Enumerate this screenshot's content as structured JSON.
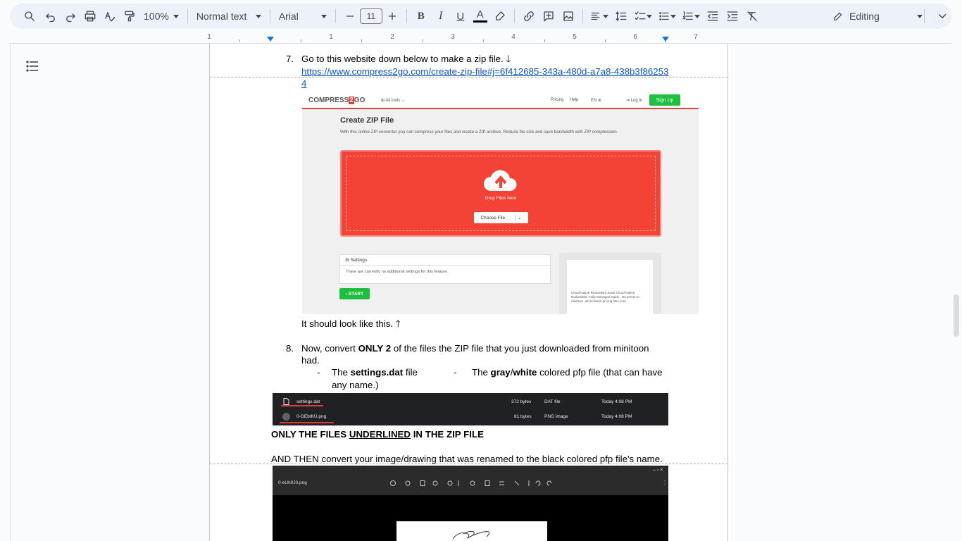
{
  "toolbar": {
    "zoom": "100%",
    "style": "Normal text",
    "font": "Arial",
    "font_size": "11",
    "bold": "B",
    "italic": "I",
    "underline": "U",
    "text_color": "A",
    "mode": "Editing",
    "icons": [
      "search-icon",
      "undo-icon",
      "redo-icon",
      "print-icon",
      "spellcheck-icon",
      "paint-format-icon",
      "minus-icon",
      "plus-icon",
      "highlighter-icon",
      "link-icon",
      "add-comment-icon",
      "insert-image-icon",
      "align-icon",
      "line-spacing-icon",
      "checklist-icon",
      "bullet-list-icon",
      "numbered-list-icon",
      "decrease-indent-icon",
      "increase-indent-icon",
      "clear-formatting-icon",
      "pencil-icon",
      "collapse-chevron-icon"
    ]
  },
  "ruler": {
    "numbers": [
      "1",
      "1",
      "2",
      "3",
      "4",
      "5",
      "6",
      "7"
    ]
  },
  "doc": {
    "item7_num": "7.",
    "item7_text": "Go to this website down below to make a zip file. 🡓",
    "item7_link_line1": "https://www.compress2go.com/create-zip-file#j=6f412685-343a-480d-a7a8-438b3f86253",
    "item7_link_line2": "4",
    "look_like": "It should look like this. 🡑",
    "item8_num": "8.",
    "item8_pre": "Now, convert ",
    "item8_bold": "ONLY 2",
    "item8_post": " of the files the ZIP file that you just downloaded from minitoon",
    "item8_line2": "had.",
    "dash": "-",
    "sub1_pre": "The ",
    "sub1_bold": "settings.dat",
    "sub1_post": " file",
    "sub2_pre": "The ",
    "sub2_bold1": "gray",
    "sub2_slash": "/",
    "sub2_bold2": "white",
    "sub2_post": " colored pfp file (that can have",
    "sub2_line2": "any name.)",
    "only_files_pre": "ONLY THE FILES ",
    "only_files_u": "UNDERLINED",
    "only_files_post": " IN THE ZIP FILE",
    "and_then": "AND THEN convert your image/drawing that was renamed to the black colored pfp file's name."
  },
  "shot1": {
    "logo_a": "COMPRESS",
    "logo_b": "2",
    "logo_c": "GO",
    "all_tools": "⊞  All tools  ⌄",
    "pricing": "Pricing",
    "help": "Help",
    "lang": "EN ⊕",
    "login": "⇥ Log In",
    "signup": "Sign Up",
    "title": "Create ZIP File",
    "desc": "With this online ZIP converter you can compress your files and create a ZIP archive. Reduce file size and save bandwidth with ZIP compression.",
    "drop": "Drop Files here",
    "choose": "Choose File",
    "settings": "⚙ Settings",
    "settings_body": "There are currently no additional settings for this feature.",
    "start": "› START",
    "ad": "Cloud Native Redundant SaaS Cloud Native, Redundant, Fully Managed SaaS - No server to maintain. all inclusive pricing files.com"
  },
  "shot2": {
    "rows": [
      {
        "name": "settings.dat",
        "size": "372 bytes",
        "type": "DAT file",
        "date": "Today 4:08 PM"
      },
      {
        "name": "0-GEbtKU.png",
        "size": "81 bytes",
        "type": "PNG image",
        "date": "Today 4:08 PM"
      }
    ]
  },
  "shot3": {
    "filename": "0-eUh0J0.png"
  },
  "colors": {
    "accent": "#1a73e8",
    "toolbar_bg": "#edf2fa",
    "link": "#1155cc",
    "brand_red": "#f44336",
    "brand_green": "#1dbf3f"
  }
}
